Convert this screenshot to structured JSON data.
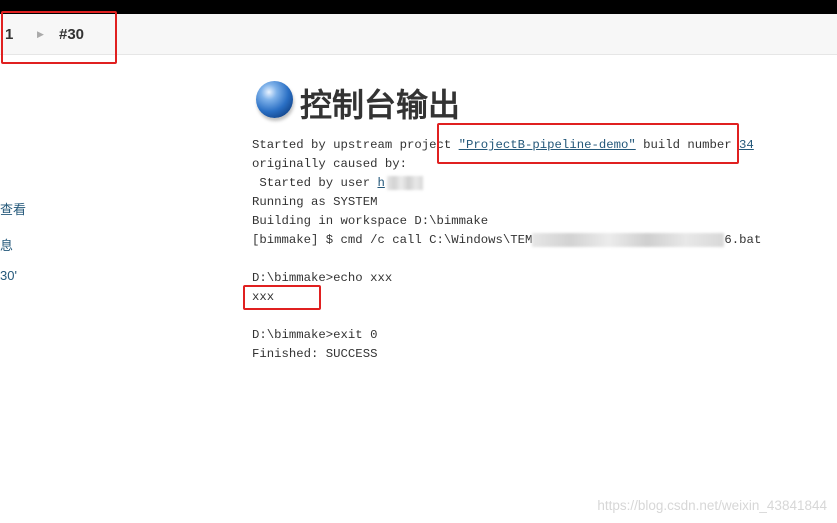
{
  "breadcrumb": {
    "item_prefix": "1",
    "build": "#30"
  },
  "sidebar": {
    "links": [
      "查看",
      "息",
      "30'"
    ]
  },
  "page": {
    "title": "控制台输出"
  },
  "console": {
    "l1_pre": "Started by upstream project ",
    "l1_project": "\"ProjectB-pipeline-demo\"",
    "l1_mid": " build number ",
    "l1_build": "34",
    "l2": "originally caused by:",
    "l3_pre": " Started by user ",
    "l3_user": "h",
    "l4": "Running as SYSTEM",
    "l5": "Building in workspace D:\\bimmake",
    "l6_pre": "[bimmake] $ cmd /c call C:\\Windows\\TEM",
    "l6_post": "6.bat",
    "l7": "D:\\bimmake>echo xxx",
    "l8": "xxx",
    "l9": "D:\\bimmake>exit 0",
    "l10": "Finished: SUCCESS"
  },
  "watermark": "https://blog.csdn.net/weixin_43841844",
  "colors": {
    "highlight": "#e02020",
    "link": "#24587a"
  }
}
